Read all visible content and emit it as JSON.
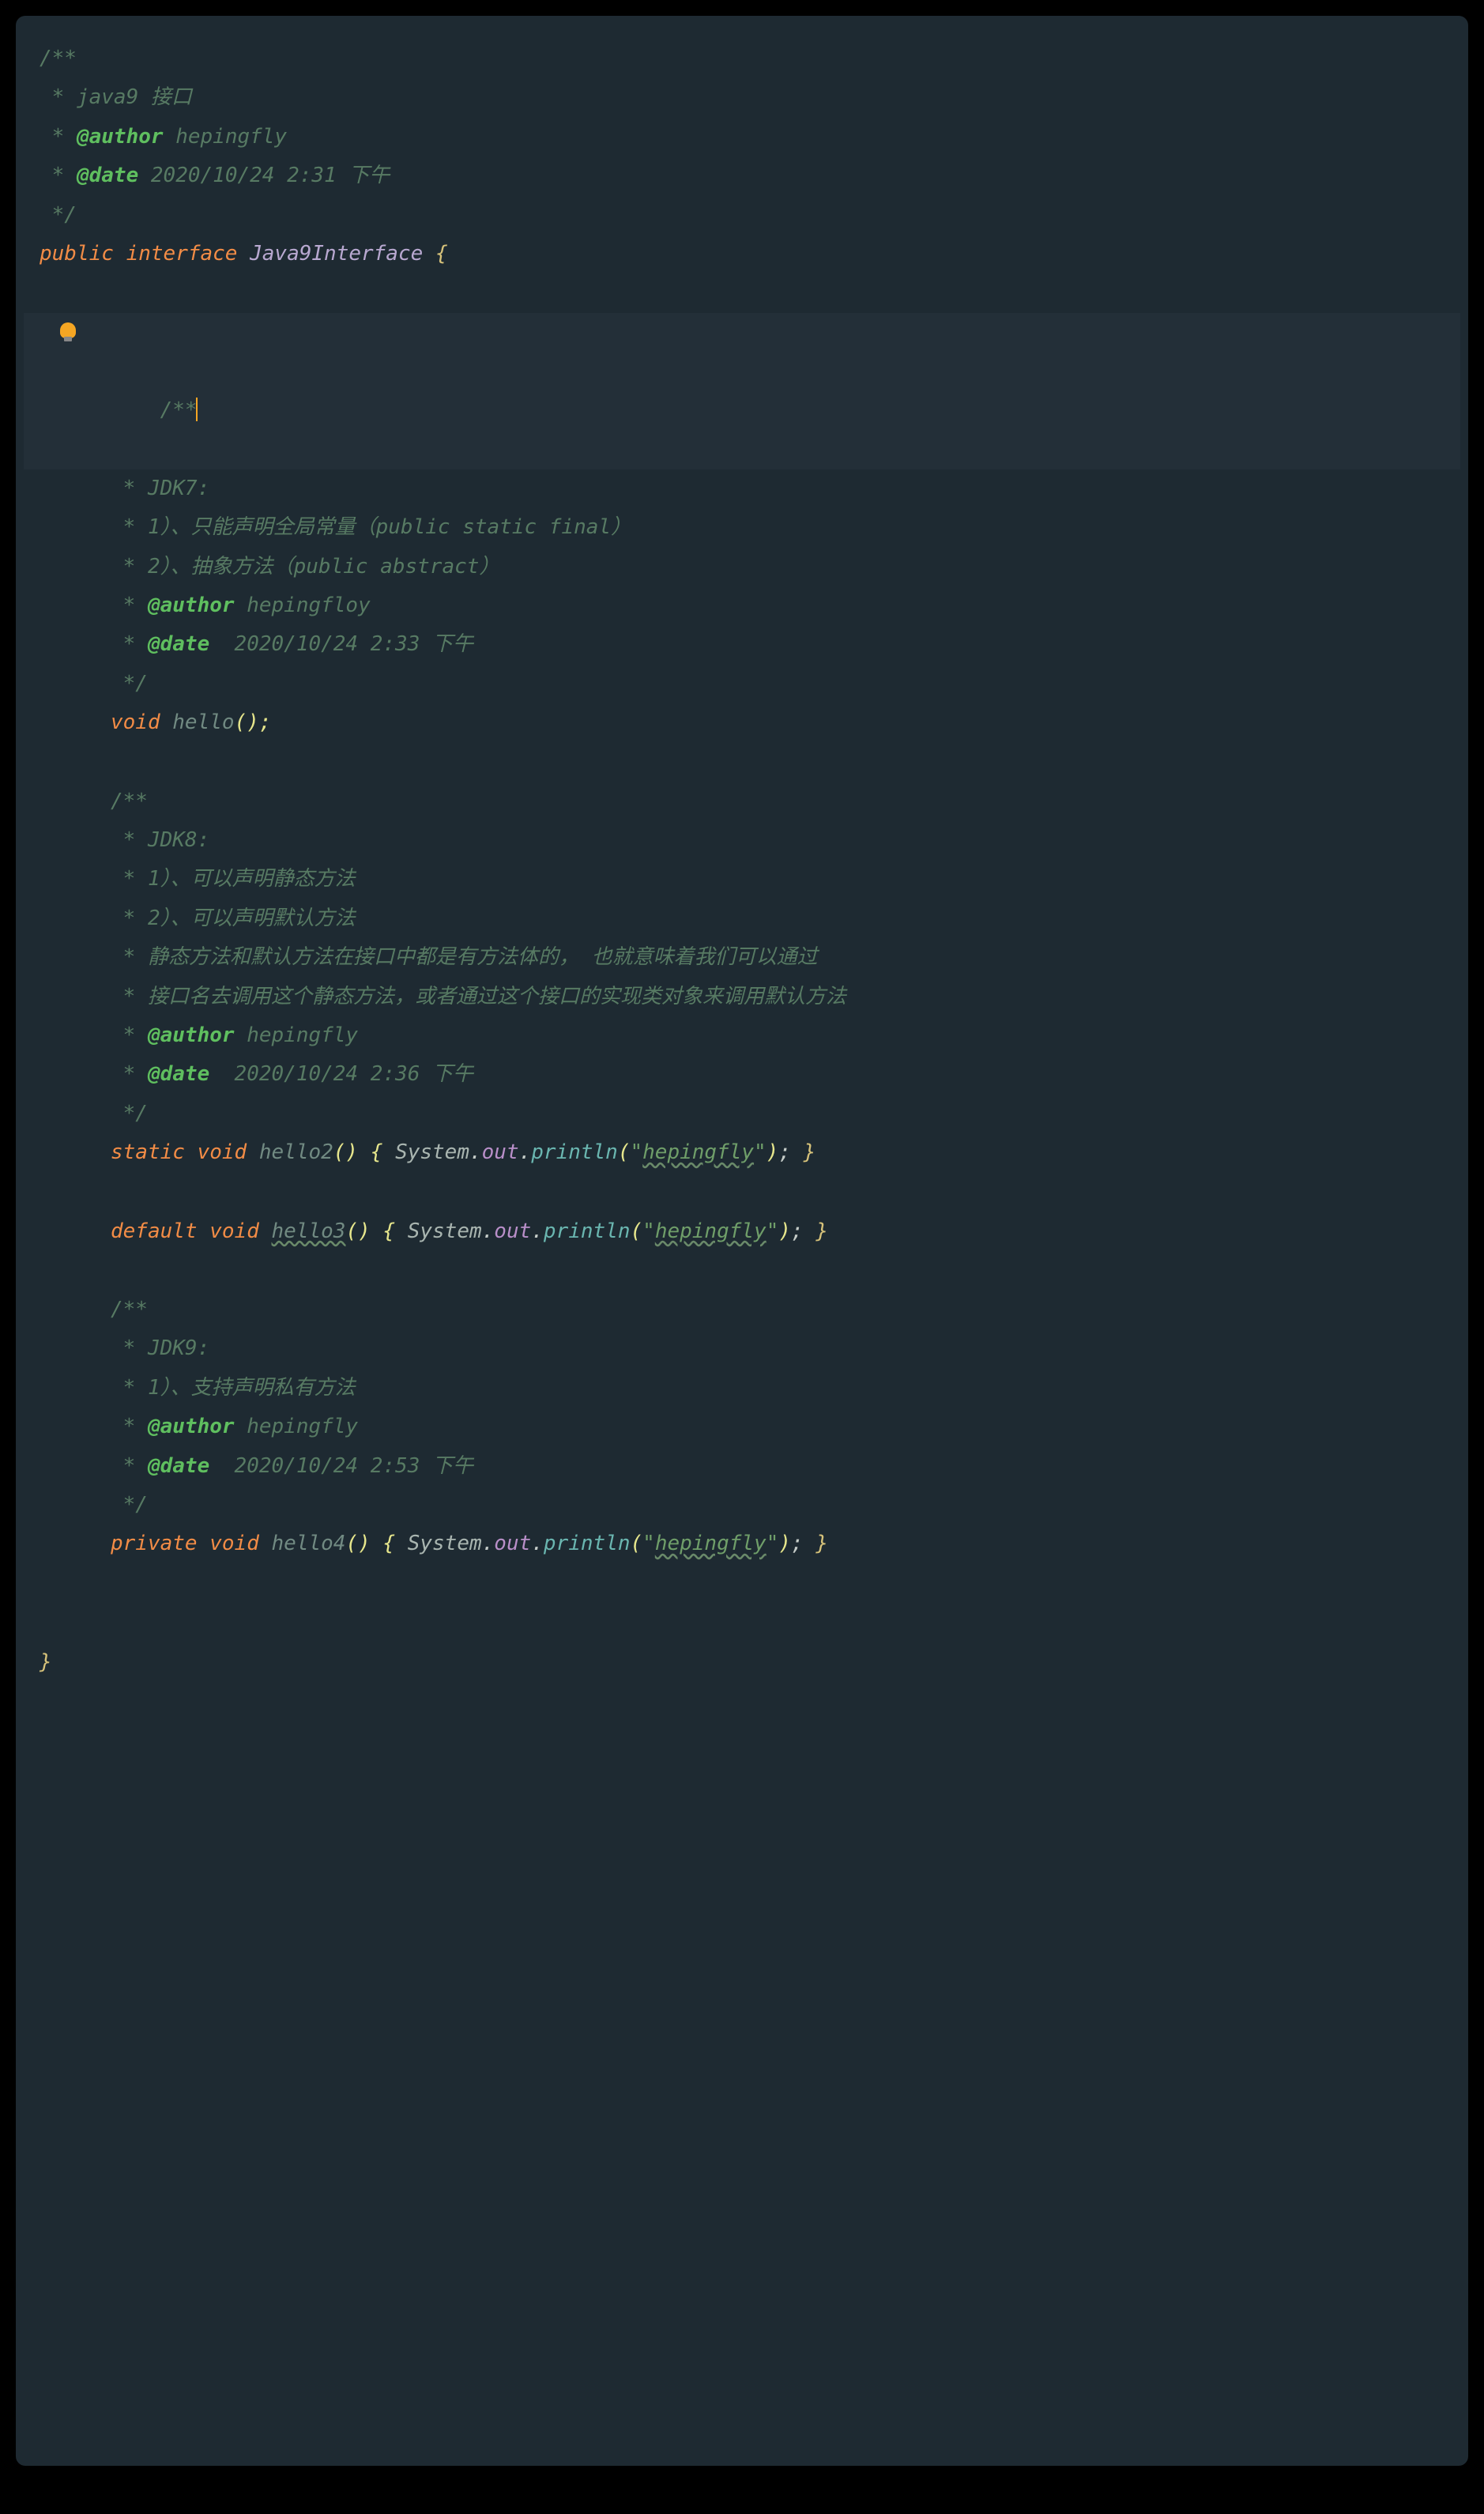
{
  "header": {
    "open": "/**",
    "l1": " * java9 接口",
    "author_tag": "@author",
    "author_val": " hepingfly",
    "date_tag": "@date",
    "date_val": " 2020/10/24 2:31 下午",
    "close": " */"
  },
  "decl": {
    "kw_public": "public ",
    "kw_interface": "interface ",
    "name": "Java9Interface ",
    "brace": "{"
  },
  "block1": {
    "open": "/**",
    "l1": " * JDK7:",
    "l2": " * 1）、只能声明全局常量（public static final）",
    "l3": " * 2）、抽象方法（public abstract）",
    "author_tag": "@author",
    "author_val": " hepingfloy",
    "date_tag": "@date",
    "date_val": "  2020/10/24 2:33 下午",
    "close": " */",
    "void": "void ",
    "fn": "hello",
    "after": "();"
  },
  "block2": {
    "open": "/**",
    "l1": " * JDK8:",
    "l2": " * 1）、可以声明静态方法",
    "l3": " * 2）、可以声明默认方法",
    "l4": " * 静态方法和默认方法在接口中都是有方法体的， 也就意味着我们可以通过",
    "l5": " * 接口名去调用这个静态方法，或者通过这个接口的实现类对象来调用默认方法",
    "author_tag": "@author",
    "author_val": " hepingfly",
    "date_tag": "@date",
    "date_val": "  2020/10/24 2:36 下午",
    "close": " */",
    "static": "static ",
    "void": "void ",
    "fn2": "hello2",
    "default": "default ",
    "fn3": "hello3",
    "body_open": "() { ",
    "sys": "System",
    "dot": ".",
    "out": "out",
    "println": "println",
    "po": "(",
    "q": "\"",
    "str": "hepingfly",
    "pc": ")",
    "semi": "; ",
    "brace_close": "}"
  },
  "block3": {
    "open": "/**",
    "l1": " * JDK9:",
    "l2": " * 1）、支持声明私有方法",
    "author_tag": "@author",
    "author_val": " hepingfly",
    "date_tag": "@date",
    "date_val": "  2020/10/24 2:53 下午",
    "close": " */",
    "private": "private ",
    "void": "void ",
    "fn4": "hello4"
  },
  "end_brace": "}",
  "star_prefix": " * "
}
